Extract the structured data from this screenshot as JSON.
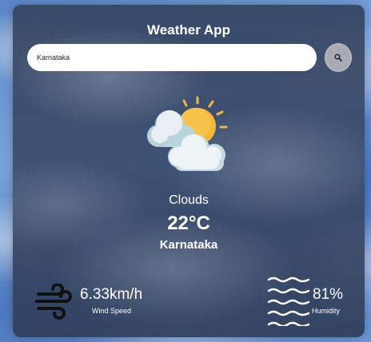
{
  "app": {
    "title": "Weather App"
  },
  "search": {
    "value": "Karnataka",
    "button_icon": "search-icon"
  },
  "weather": {
    "icon": "sun-behind-clouds-icon",
    "condition": "Clouds",
    "temperature": "22°C",
    "city": "Karnataka"
  },
  "wind": {
    "icon": "wind-icon",
    "value": "6.33km/h",
    "label": "Wind Speed"
  },
  "humidity": {
    "icon": "humidity-waves-icon",
    "value": "81%",
    "label": "Humidity"
  },
  "colors": {
    "sun": "#f5b833",
    "cloud": "#e8eef2",
    "cloud_shade": "#b9d3dc"
  }
}
